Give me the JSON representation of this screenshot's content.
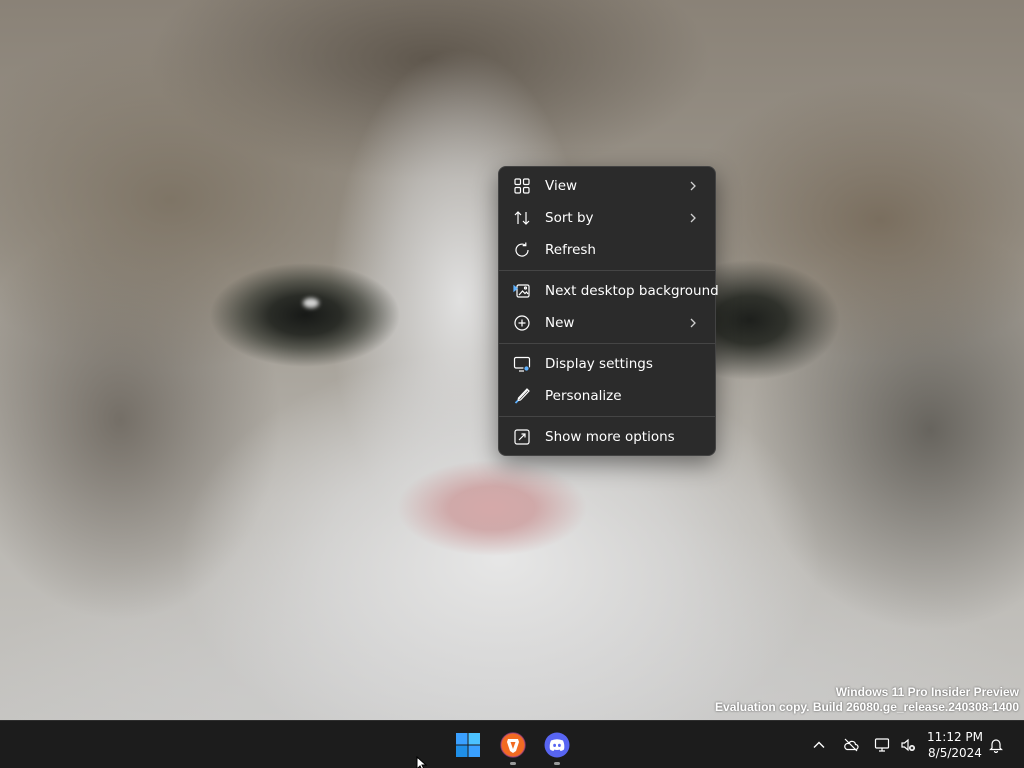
{
  "desktop": {
    "watermark_line1": "Windows 11 Pro Insider Preview",
    "watermark_line2": "Evaluation copy. Build 26080.ge_release.240308-1400"
  },
  "context_menu": {
    "groups": [
      [
        {
          "label": "View",
          "icon": "view-grid-icon",
          "has_submenu": true
        },
        {
          "label": "Sort by",
          "icon": "sort-icon",
          "has_submenu": true
        },
        {
          "label": "Refresh",
          "icon": "refresh-icon",
          "has_submenu": false
        }
      ],
      [
        {
          "label": "Next desktop background",
          "icon": "next-background-icon",
          "has_submenu": false
        },
        {
          "label": "New",
          "icon": "new-plus-icon",
          "has_submenu": true
        }
      ],
      [
        {
          "label": "Display settings",
          "icon": "display-settings-icon",
          "has_submenu": false
        },
        {
          "label": "Personalize",
          "icon": "personalize-brush-icon",
          "has_submenu": false
        }
      ],
      [
        {
          "label": "Show more options",
          "icon": "show-more-options-icon",
          "has_submenu": false
        }
      ]
    ]
  },
  "taskbar": {
    "apps": [
      {
        "name": "Start",
        "icon": "windows-start-icon"
      },
      {
        "name": "Brave Nightly",
        "icon": "brave-browser-icon",
        "running": true
      },
      {
        "name": "Discord",
        "icon": "discord-icon",
        "running": true
      }
    ],
    "tray": {
      "icons": [
        "show-hidden-icons-chevron",
        "onedrive-offline-icon",
        "network-icon",
        "volume-muted-icon",
        "notifications-bell-icon"
      ]
    },
    "clock": {
      "time": "11:12 PM",
      "date": "8/5/2024"
    }
  },
  "colors": {
    "menu_bg": "#2b2b2b",
    "taskbar_bg": "#1c1c1c",
    "start_blue": "#3aa0ff",
    "brave_orange": "#f26b22",
    "discord_blurple": "#5865f2"
  }
}
